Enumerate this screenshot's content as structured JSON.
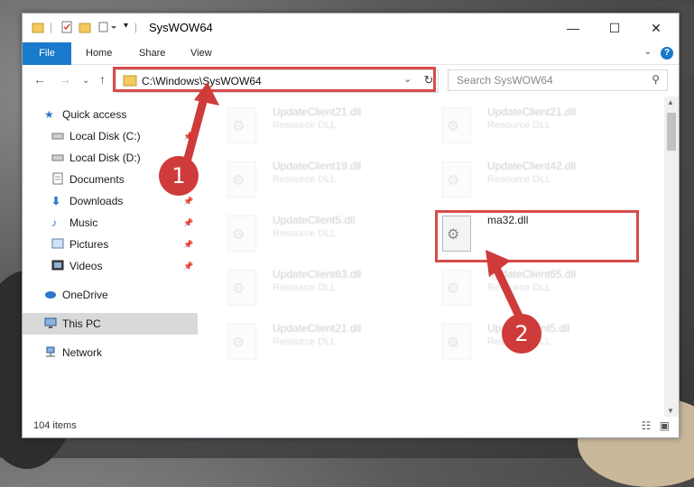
{
  "window": {
    "title": "SysWOW64"
  },
  "ribbon": {
    "tabs": [
      "File",
      "Home",
      "Share",
      "View"
    ]
  },
  "address": {
    "path": "C:\\Windows\\SysWOW64"
  },
  "search": {
    "placeholder": "Search SysWOW64"
  },
  "sidebar": {
    "items": [
      {
        "label": "Quick access"
      },
      {
        "label": "Local Disk (C:)"
      },
      {
        "label": "Local Disk (D:)"
      },
      {
        "label": "Documents"
      },
      {
        "label": "Downloads"
      },
      {
        "label": "Music"
      },
      {
        "label": "Pictures"
      },
      {
        "label": "Videos"
      },
      {
        "label": "OneDrive"
      },
      {
        "label": "This PC"
      },
      {
        "label": "Network"
      }
    ]
  },
  "files": [
    {
      "name": "UpdateClient21.dll",
      "type": "Resource DLL"
    },
    {
      "name": "UpdateClient21.dll",
      "type": "Resource DLL"
    },
    {
      "name": "UpdateClient19.dll",
      "type": "Resource DLL"
    },
    {
      "name": "UpdateClient42.dll",
      "type": "Resource DLL"
    },
    {
      "name": "UpdateClient5.dll",
      "type": "Resource DLL"
    },
    {
      "name": "ma32.dll",
      "type": ""
    },
    {
      "name": "UpdateClient63.dll",
      "type": "Resource DLL"
    },
    {
      "name": "UpdateClient65.dll",
      "type": "Resource DLL"
    },
    {
      "name": "UpdateClient21.dll",
      "type": "Resource DLL"
    },
    {
      "name": "UpdateClient5.dll",
      "type": "Resource DLL"
    }
  ],
  "status": {
    "items_count": "104 items"
  },
  "markers": {
    "step1": "1",
    "step2": "2"
  },
  "colors": {
    "accent": "#1979ca",
    "highlight": "#d64b4b"
  }
}
